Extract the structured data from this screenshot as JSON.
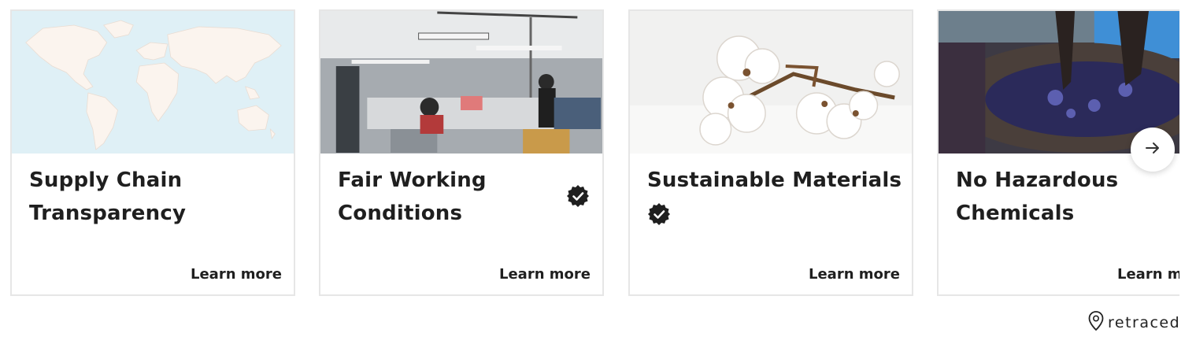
{
  "cards": [
    {
      "title_line1": "Supply Chain",
      "title_line2": "Transparency",
      "link": "Learn more",
      "verified": false,
      "image": "world-map"
    },
    {
      "title_line1": "Fair Working",
      "title_line2": "Conditions",
      "link": "Learn more",
      "verified": true,
      "image": "garment-factory"
    },
    {
      "title": "Sustainable Materials",
      "link": "Learn more",
      "verified": true,
      "image": "cotton-bolls"
    },
    {
      "title_line1": "No Hazardous",
      "title_line2": "Chemicals",
      "link": "Learn more",
      "verified": false,
      "image": "dye-bath"
    }
  ],
  "controls": {
    "next_icon": "arrow-right-icon"
  },
  "brand": {
    "name": "retraced",
    "icon": "map-pin-icon"
  },
  "colors": {
    "map_sea": "#dff0f6",
    "map_land": "#fbf4ee",
    "border": "#e6e6e6",
    "text": "#1f1f1f"
  }
}
